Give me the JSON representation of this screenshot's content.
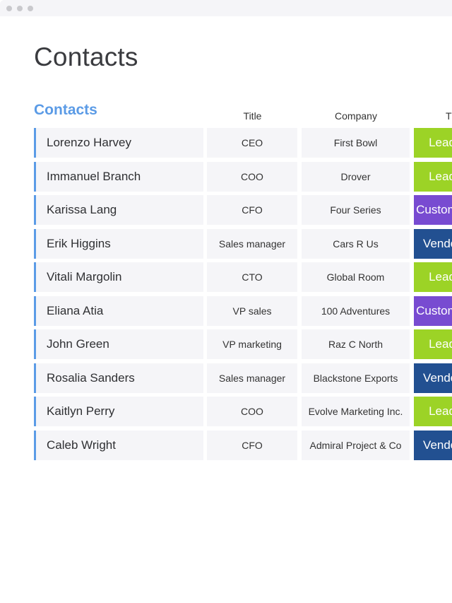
{
  "window": {
    "controls": [
      "window-dot",
      "window-dot",
      "window-dot"
    ]
  },
  "page": {
    "title": "Contacts"
  },
  "board": {
    "group_title": "Contacts",
    "columns": {
      "name": "",
      "title": "Title",
      "company": "Company",
      "tag": "Type"
    },
    "tag_colors": {
      "Lead": "#9cd326",
      "Customer": "#784bd1",
      "Vendor": "#225091"
    },
    "rows": [
      {
        "name": "Lorenzo Harvey",
        "title": "CEO",
        "company": "First Bowl",
        "tag": "Lead"
      },
      {
        "name": "Immanuel Branch",
        "title": "COO",
        "company": "Drover",
        "tag": "Lead"
      },
      {
        "name": "Karissa Lang",
        "title": "CFO",
        "company": "Four Series",
        "tag": "Customer"
      },
      {
        "name": "Erik Higgins",
        "title": "Sales manager",
        "company": "Cars R Us",
        "tag": "Vendor"
      },
      {
        "name": "Vitali Margolin",
        "title": "CTO",
        "company": "Global Room",
        "tag": "Lead"
      },
      {
        "name": "Eliana Atia",
        "title": "VP sales",
        "company": "100 Adventures",
        "tag": "Customer"
      },
      {
        "name": "John Green",
        "title": "VP marketing",
        "company": "Raz C North",
        "tag": "Lead"
      },
      {
        "name": "Rosalia Sanders",
        "title": "Sales manager",
        "company": "Blackstone Exports",
        "tag": "Vendor"
      },
      {
        "name": "Kaitlyn Perry",
        "title": "COO",
        "company": "Evolve Marketing Inc.",
        "tag": "Lead"
      },
      {
        "name": "Caleb Wright",
        "title": "CFO",
        "company": "Admiral Project & Co",
        "tag": "Vendor"
      }
    ]
  }
}
